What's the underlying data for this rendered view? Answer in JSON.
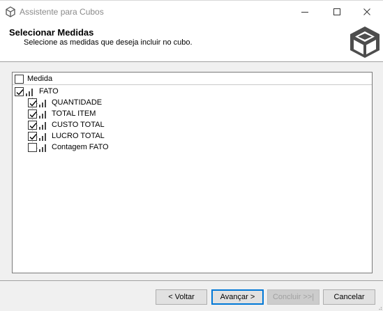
{
  "window": {
    "title": "Assistente para Cubos"
  },
  "header": {
    "title": "Selecionar Medidas",
    "subtitle": "Selecione as medidas que deseja incluir no cubo."
  },
  "tree": {
    "column_header": "Medida",
    "column_checked": false,
    "root": {
      "label": "FATO",
      "checked": true,
      "icon": "measure-group-icon"
    },
    "measures": [
      {
        "label": "QUANTIDADE",
        "checked": true,
        "icon": "measure-icon"
      },
      {
        "label": "TOTAL ITEM",
        "checked": true,
        "icon": "measure-icon"
      },
      {
        "label": "CUSTO TOTAL",
        "checked": true,
        "icon": "measure-icon"
      },
      {
        "label": "LUCRO TOTAL",
        "checked": true,
        "icon": "measure-icon"
      },
      {
        "label": "Contagem FATO",
        "checked": false,
        "icon": "measure-icon"
      }
    ]
  },
  "buttons": {
    "back": "< Voltar",
    "next": "Avançar >",
    "finish": "Concluir >>|",
    "cancel": "Cancelar"
  },
  "colors": {
    "accent": "#0078d7",
    "disabled_text": "#a0a0a0"
  }
}
